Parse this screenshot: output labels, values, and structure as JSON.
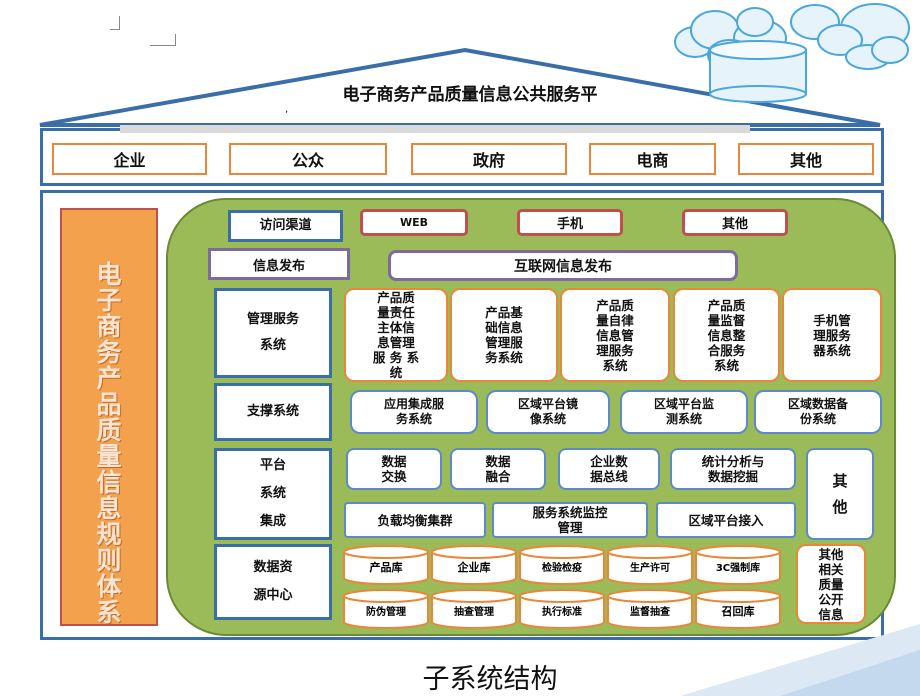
{
  "title": "电子商务产品质量信息公共服务平",
  "roof_stub": ",",
  "users": [
    "企业",
    "公众",
    "政府",
    "电商",
    "其他"
  ],
  "side_title": "电子商务产品质量信息规则体系",
  "rows": {
    "access": {
      "label": "访问渠道",
      "items": [
        "WEB",
        "手机",
        "其他"
      ]
    },
    "publish": {
      "label": "信息发布",
      "item": "互联网信息发布"
    },
    "mgmt": {
      "label": "管理服务\n系统",
      "items": [
        "产品质\n量责任\n主体信\n息管理\n服 务 系\n统",
        "产品基\n础信息\n管理服\n务系统",
        "产品质\n量自律\n信息管\n理服务\n系统",
        "产品质\n量监督\n信息整\n合服务\n系统",
        "手机管\n理服务\n器系统"
      ]
    },
    "support": {
      "label": "支撑系统",
      "items": [
        "应用集成服\n务系统",
        "区域平台镜\n像系统",
        "区域平台监\n测系统",
        "区域数据备\n份系统"
      ]
    },
    "platform": {
      "label": "平台\n系统\n集成",
      "top": [
        "数据\n交换",
        "数据\n融合",
        "企业数\n据总线",
        "统计分析与\n数据挖掘"
      ],
      "bottom": [
        "负载均衡集群",
        "服务系统监控\n管理",
        "区域平台接入"
      ],
      "other": "其\n他"
    },
    "data": {
      "label": "数据资\n源中心",
      "dbs_top": [
        "产品库",
        "企业库",
        "检验检疫",
        "生产许可",
        "3C强制库"
      ],
      "dbs_bottom": [
        "防伪管理",
        "抽查管理",
        "执行标准",
        "监督抽查",
        "召回库"
      ],
      "other": "其他\n相关\n质量\n公开\n信息"
    }
  },
  "caption": "子系统结构"
}
